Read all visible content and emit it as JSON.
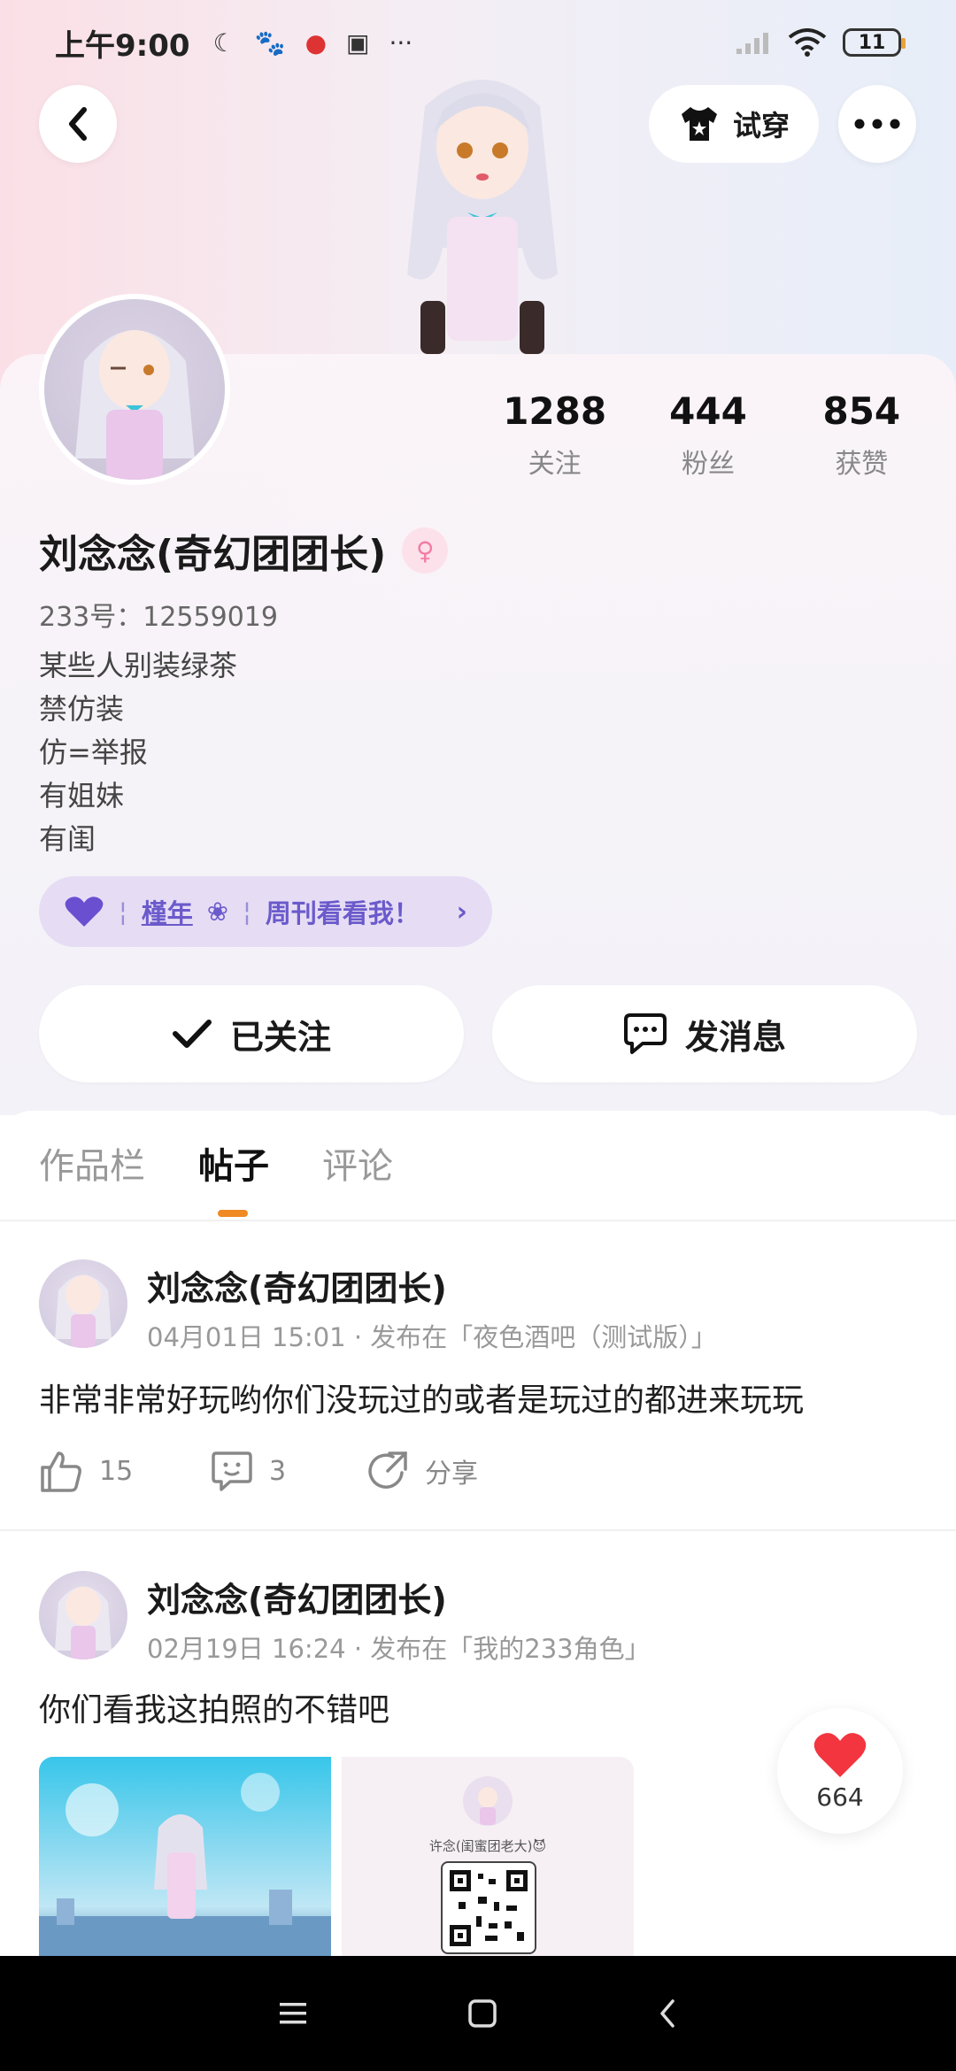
{
  "status_bar": {
    "time": "上午9:00",
    "more": "···",
    "battery": "11"
  },
  "header": {
    "tryon_label": "试穿"
  },
  "stats": [
    {
      "value": "1288",
      "label": "关注"
    },
    {
      "value": "444",
      "label": "粉丝"
    },
    {
      "value": "854",
      "label": "获赞"
    }
  ],
  "profile": {
    "name": "刘念念(奇幻团团长)",
    "uid": "233号：12559019",
    "bio": [
      "某些人别装绿茶",
      "禁仿装",
      "仿=举报",
      "有姐妹",
      "有闺"
    ],
    "weekly_tag": "槿年",
    "weekly_text": "周刊看看我！"
  },
  "actions": {
    "follow_label": "已关注",
    "message_label": "发消息"
  },
  "tabs": [
    "作品栏",
    "帖子",
    "评论"
  ],
  "posts": [
    {
      "author": "刘念念(奇幻团团长)",
      "meta": "04月01日 15:01 · 发布在「夜色酒吧（测试版）」",
      "text": "非常非常好玩哟你们没玩过的或者是玩过的都进来玩玩",
      "likes": "15",
      "comments": "3",
      "share": "分享"
    },
    {
      "author": "刘念念(奇幻团团长)",
      "meta": "02月19日 16:24 · 发布在「我的233角色」",
      "text": "你们看我这拍照的不错吧",
      "image_caption": "许念(闺蜜团老大)😈"
    }
  ],
  "floating_like": {
    "count": "664"
  },
  "colors": {
    "accent": "#f08a22",
    "weekly_bg": "#e6ddf5",
    "weekly_text": "#6b5acb",
    "heart": "#f2353f"
  }
}
